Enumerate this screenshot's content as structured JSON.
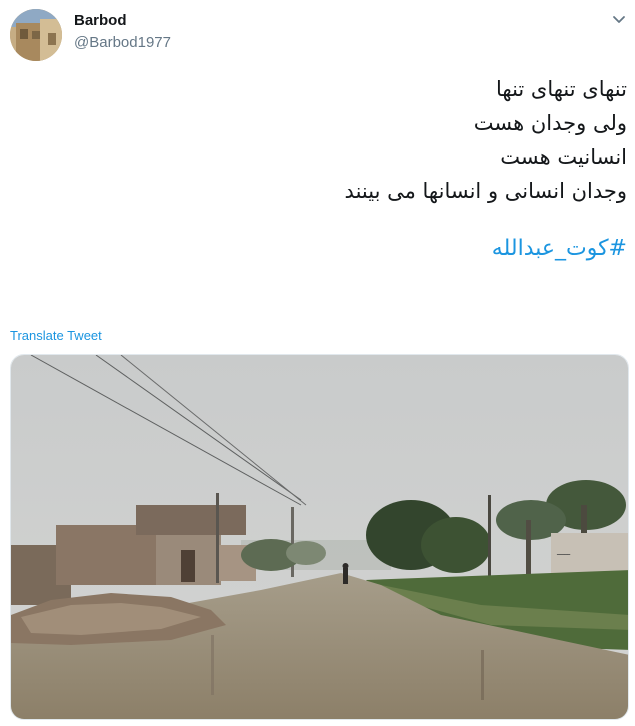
{
  "header": {
    "display_name": "Barbod",
    "username": "@Barbod1977",
    "avatar_icon": "avatar-photo-icon",
    "menu_icon": "chevron-down-icon"
  },
  "tweet": {
    "lines": [
      "تنهای تنهای تنها",
      "ولی وجدان هست",
      "انسانیت هست",
      "وجدان انسانی و انسانها می بینند"
    ],
    "hashtag": "#كوت_عبدالله",
    "link_color": "#1b95e0"
  },
  "translate_label": "Translate Tweet",
  "media": {
    "description_icon": "flooded-street-photo"
  }
}
